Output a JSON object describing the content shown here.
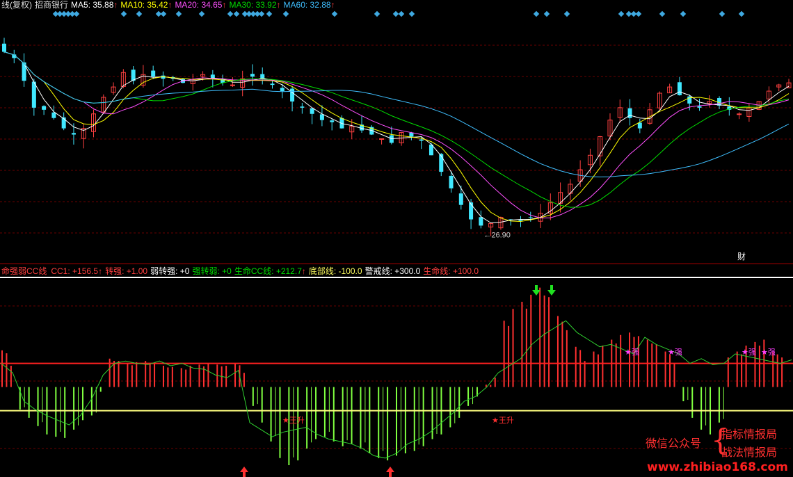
{
  "header": {
    "title": "线(复权)",
    "stock": "招商银行",
    "ma": [
      {
        "label": "MA5:",
        "value": "35.88",
        "arrow": "↑",
        "color": "#ffffff"
      },
      {
        "label": "MA10:",
        "value": "35.42",
        "arrow": "↑",
        "color": "#ffff00"
      },
      {
        "label": "MA20:",
        "value": "34.65",
        "arrow": "↑",
        "color": "#ff50ff"
      },
      {
        "label": "MA30:",
        "value": "33.92",
        "arrow": "↑",
        "color": "#00dd00"
      },
      {
        "label": "MA60:",
        "value": "32.88",
        "arrow": "↑",
        "color": "#3fbfff"
      }
    ]
  },
  "indicator_header": {
    "name": "命强弱CC线",
    "items": [
      {
        "label": "CC1:",
        "value": "+156.5",
        "arrow": "↑",
        "color": "#ff4040"
      },
      {
        "label": "转强:",
        "value": "+1.00",
        "arrow": "",
        "color": "#ff4040"
      },
      {
        "label": "弱转强:",
        "value": "+0",
        "arrow": "",
        "color": "#ffffff"
      },
      {
        "label": "强转弱:",
        "value": "+0",
        "arrow": "",
        "color": "#00dd00"
      },
      {
        "label": "生命CC线:",
        "value": "+212.7",
        "arrow": "↑",
        "color": "#00dd00"
      },
      {
        "label": "底部线:",
        "value": "-100.0",
        "arrow": "",
        "color": "#ffff60"
      },
      {
        "label": "警戒线:",
        "value": "+300.0",
        "arrow": "",
        "color": "#ffffff"
      },
      {
        "label": "生命线:",
        "value": "+100.0",
        "arrow": "",
        "color": "#ff4040"
      }
    ]
  },
  "annotations": {
    "low_label": "26.90",
    "finance_badge": "财",
    "wang_label": "王升",
    "strong_label": "强"
  },
  "watermark": {
    "wechat": "微信公众号",
    "brace": "{",
    "line1": "指标情报局",
    "line2": "战法情报局",
    "url": "www.zhibiao168.com"
  },
  "chart_data": [
    {
      "type": "candlestick",
      "low_annotation": 26.9,
      "close_trend": [
        35.6,
        35.3,
        34.2,
        32.9,
        32.8,
        32.4,
        31.9,
        31.6,
        31.9,
        32.6,
        33.4,
        33.9,
        34.6,
        34.2,
        34.5,
        34.4,
        34.3,
        34.3,
        34.1,
        34.2,
        34.5,
        34.3,
        34.1,
        34.0,
        34.3,
        34.4,
        34.3,
        34.0,
        33.7,
        33.2,
        32.9,
        32.6,
        32.3,
        32.2,
        31.9,
        32.0,
        31.8,
        31.6,
        31.4,
        31.2,
        31.7,
        31.5,
        31.3,
        30.6,
        29.8,
        29.0,
        28.2,
        27.5,
        27.2,
        27.3,
        27.6,
        27.5,
        27.4,
        27.6,
        27.8,
        28.3,
        28.8,
        29.2,
        29.9,
        30.6,
        31.5,
        32.3,
        32.9,
        32.4,
        31.9,
        32.8,
        33.6,
        33.9,
        33.5,
        33.1,
        32.9,
        33.2,
        33.0,
        32.8,
        32.6,
        32.9,
        33.2,
        33.7,
        34.0,
        34.1
      ]
    },
    {
      "type": "bar",
      "baseline": 0,
      "histogram_values": [
        155,
        90,
        -95,
        -130,
        -165,
        -200,
        -210,
        -215,
        -180,
        -140,
        -120,
        -20,
        120,
        110,
        100,
        105,
        110,
        100,
        90,
        85,
        80,
        90,
        95,
        100,
        95,
        90,
        100,
        60,
        -80,
        -150,
        -230,
        -300,
        -330,
        -310,
        -260,
        -220,
        -210,
        -230,
        -250,
        -240,
        -260,
        -280,
        -300,
        -310,
        -290,
        -280,
        -270,
        -250,
        -220,
        -200,
        -170,
        -130,
        -80,
        -40,
        10,
        40,
        280,
        330,
        360,
        390,
        420,
        380,
        300,
        240,
        170,
        110,
        150,
        175,
        200,
        220,
        230,
        215,
        200,
        180,
        150,
        100,
        -60,
        -130,
        -180,
        -200,
        -150,
        125,
        150,
        175,
        190,
        200,
        150,
        125
      ],
      "cc_line": [
        100,
        60,
        -60,
        -95,
        -120,
        -140,
        -160,
        -120,
        -50,
        50,
        100,
        110,
        100,
        95,
        110,
        90,
        100,
        80,
        75,
        50,
        40,
        70,
        -150,
        -180,
        -210,
        -190,
        -180,
        -170,
        -200,
        -220,
        -230,
        -240,
        -260,
        -290,
        -300,
        -280,
        -240,
        -220,
        -190,
        -150,
        -110,
        -60,
        -40,
        0,
        60,
        90,
        120,
        180,
        220,
        250,
        280,
        230,
        200,
        170,
        180,
        160,
        140,
        210,
        180,
        160,
        140,
        100,
        120,
        95,
        100,
        140,
        130,
        120,
        110,
        100,
        115
      ],
      "reference_lines": {
        "life_line": 100,
        "bottom_line": -100
      },
      "markers": {
        "green_down_arrows": 2,
        "red_up_arrows": 2
      }
    }
  ]
}
